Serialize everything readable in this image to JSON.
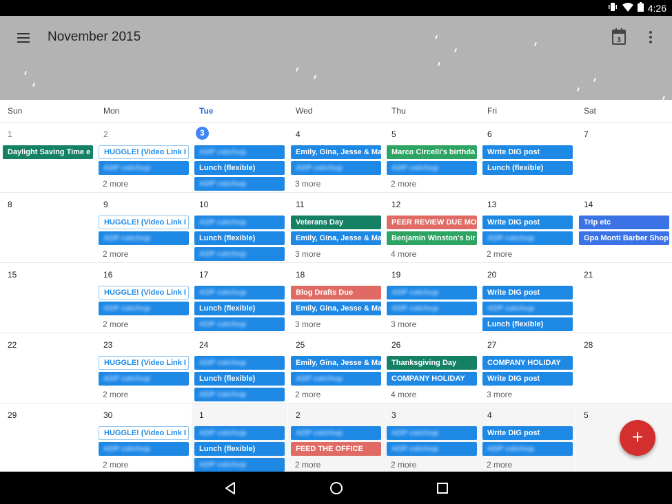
{
  "status_bar": {
    "time": "4:26",
    "icons": [
      "vibrate-icon",
      "wifi-icon",
      "battery-icon"
    ]
  },
  "app_bar": {
    "title": "November 2015",
    "today_icon_day": "3",
    "icons": [
      "menu-icon",
      "today-calendar-icon",
      "more-vert-icon"
    ]
  },
  "days_of_week": [
    "Sun",
    "Mon",
    "Tue",
    "Wed",
    "Thu",
    "Fri",
    "Sat"
  ],
  "today_index": 2,
  "colors": {
    "blue": "#1e88e5",
    "teal": "#148064",
    "green": "#2da462",
    "red": "#e06b64",
    "royal": "#3b73e6",
    "today": "#4285f4",
    "fab": "#d32f2f"
  },
  "weeks": [
    {
      "days": [
        {
          "num": "1",
          "events": [
            {
              "title": "Daylight Saving Time e",
              "color": "teal"
            }
          ]
        },
        {
          "num": "2",
          "events": [
            {
              "title": "HUGGLE! (Video Link I",
              "color": "outline"
            },
            {
              "title": "ADP catchup",
              "color": "blue",
              "blurred": true
            }
          ],
          "more": "2 more"
        },
        {
          "num": "3",
          "today": true,
          "events": [
            {
              "title": "ADP catchup",
              "color": "blue",
              "blurred": true
            },
            {
              "title": "Lunch (flexible)",
              "color": "blue"
            },
            {
              "title": "ADP catchup",
              "color": "blue",
              "blurred": true
            }
          ]
        },
        {
          "num": "4",
          "events": [
            {
              "title": "Emily, Gina, Jesse & Ma",
              "color": "blue"
            },
            {
              "title": "ADP catchup",
              "color": "blue",
              "blurred": true
            }
          ],
          "more": "3 more"
        },
        {
          "num": "5",
          "events": [
            {
              "title": "Marco Circelli's birthda",
              "color": "green"
            },
            {
              "title": "ADP catchup",
              "color": "blue",
              "blurred": true
            }
          ],
          "more": "2 more"
        },
        {
          "num": "6",
          "events": [
            {
              "title": "Write DIG post",
              "color": "blue"
            },
            {
              "title": "Lunch (flexible)",
              "color": "blue"
            }
          ]
        },
        {
          "num": "7",
          "events": []
        }
      ]
    },
    {
      "days": [
        {
          "num": "8",
          "events": []
        },
        {
          "num": "9",
          "events": [
            {
              "title": "HUGGLE! (Video Link I",
              "color": "outline"
            },
            {
              "title": "ADP catchup",
              "color": "blue",
              "blurred": true
            }
          ],
          "more": "2 more"
        },
        {
          "num": "10",
          "events": [
            {
              "title": "ADP catchup",
              "color": "blue",
              "blurred": true
            },
            {
              "title": "Lunch (flexible)",
              "color": "blue"
            },
            {
              "title": "ADP catchup",
              "color": "blue",
              "blurred": true
            }
          ]
        },
        {
          "num": "11",
          "events": [
            {
              "title": "Veterans Day",
              "color": "teal"
            },
            {
              "title": "Emily, Gina, Jesse & Ma",
              "color": "blue"
            }
          ],
          "more": "3 more"
        },
        {
          "num": "12",
          "events": [
            {
              "title": "PEER REVIEW DUE MO",
              "color": "red"
            },
            {
              "title": "Benjamin Winston's bir",
              "color": "green"
            }
          ],
          "more": "4 more"
        },
        {
          "num": "13",
          "events": [
            {
              "title": "Write DIG post",
              "color": "blue"
            },
            {
              "title": "ADP catchup",
              "color": "blue",
              "blurred": true
            }
          ],
          "more": "2 more"
        },
        {
          "num": "14",
          "events": [
            {
              "title": "Trip etc",
              "color": "royal"
            },
            {
              "title": "Gpa Monti Barber Shop",
              "color": "royal"
            }
          ]
        }
      ]
    },
    {
      "days": [
        {
          "num": "15",
          "events": []
        },
        {
          "num": "16",
          "events": [
            {
              "title": "HUGGLE! (Video Link I",
              "color": "outline"
            },
            {
              "title": "ADP catchup",
              "color": "blue",
              "blurred": true
            }
          ],
          "more": "2 more"
        },
        {
          "num": "17",
          "events": [
            {
              "title": "ADP catchup",
              "color": "blue",
              "blurred": true
            },
            {
              "title": "Lunch (flexible)",
              "color": "blue"
            },
            {
              "title": "ADP catchup",
              "color": "blue",
              "blurred": true
            }
          ]
        },
        {
          "num": "18",
          "events": [
            {
              "title": "Blog Drafts Due",
              "color": "red"
            },
            {
              "title": "Emily, Gina, Jesse & Ma",
              "color": "blue"
            }
          ],
          "more": "3 more"
        },
        {
          "num": "19",
          "events": [
            {
              "title": "ADP catchup",
              "color": "blue",
              "blurred": true
            },
            {
              "title": "ADP catchup",
              "color": "blue",
              "blurred": true
            }
          ],
          "more": "3 more"
        },
        {
          "num": "20",
          "events": [
            {
              "title": "Write DIG post",
              "color": "blue"
            },
            {
              "title": "ADP catchup",
              "color": "blue",
              "blurred": true
            },
            {
              "title": "Lunch (flexible)",
              "color": "blue"
            }
          ]
        },
        {
          "num": "21",
          "events": []
        }
      ]
    },
    {
      "days": [
        {
          "num": "22",
          "events": []
        },
        {
          "num": "23",
          "events": [
            {
              "title": "HUGGLE! (Video Link I",
              "color": "outline"
            },
            {
              "title": "ADP catchup",
              "color": "blue",
              "blurred": true
            }
          ],
          "more": "2 more"
        },
        {
          "num": "24",
          "events": [
            {
              "title": "ADP catchup",
              "color": "blue",
              "blurred": true
            },
            {
              "title": "Lunch (flexible)",
              "color": "blue"
            },
            {
              "title": "ADP catchup",
              "color": "blue",
              "blurred": true
            }
          ]
        },
        {
          "num": "25",
          "events": [
            {
              "title": "Emily, Gina, Jesse & Ma",
              "color": "blue"
            },
            {
              "title": "ADP catchup",
              "color": "blue",
              "blurred": true
            }
          ],
          "more": "2 more"
        },
        {
          "num": "26",
          "events": [
            {
              "title": "Thanksgiving Day",
              "color": "teal"
            },
            {
              "title": "COMPANY HOLIDAY",
              "color": "blue"
            }
          ],
          "more": "4 more"
        },
        {
          "num": "27",
          "events": [
            {
              "title": "COMPANY HOLIDAY",
              "color": "blue"
            },
            {
              "title": "Write DIG post",
              "color": "blue"
            }
          ],
          "more": "3 more"
        },
        {
          "num": "28",
          "events": []
        }
      ]
    },
    {
      "days": [
        {
          "num": "29",
          "events": []
        },
        {
          "num": "30",
          "events": [
            {
              "title": "HUGGLE! (Video Link I",
              "color": "outline"
            },
            {
              "title": "ADP catchup",
              "color": "blue",
              "blurred": true
            }
          ],
          "more": "2 more"
        },
        {
          "num": "1",
          "other": true,
          "events": [
            {
              "title": "ADP catchup",
              "color": "blue",
              "blurred": true
            },
            {
              "title": "Lunch (flexible)",
              "color": "blue"
            },
            {
              "title": "ADP catchup",
              "color": "blue",
              "blurred": true
            }
          ]
        },
        {
          "num": "2",
          "other": true,
          "events": [
            {
              "title": "ADP catchup",
              "color": "blue",
              "blurred": true
            },
            {
              "title": "FEED THE OFFICE",
              "color": "red"
            }
          ],
          "more": "2 more"
        },
        {
          "num": "3",
          "other": true,
          "events": [
            {
              "title": "ADP catchup",
              "color": "blue",
              "blurred": true
            },
            {
              "title": "ADP catchup",
              "color": "blue",
              "blurred": true
            }
          ],
          "more": "2 more"
        },
        {
          "num": "4",
          "other": true,
          "events": [
            {
              "title": "Write DIG post",
              "color": "blue"
            },
            {
              "title": "ADP catchup",
              "color": "blue",
              "blurred": true
            }
          ],
          "more": "2 more"
        },
        {
          "num": "5",
          "other": true,
          "events": []
        }
      ]
    }
  ],
  "fab": {
    "label": "+",
    "icon": "add-icon"
  },
  "nav_bar": {
    "icons": [
      "back-icon",
      "home-icon",
      "recents-icon"
    ]
  }
}
